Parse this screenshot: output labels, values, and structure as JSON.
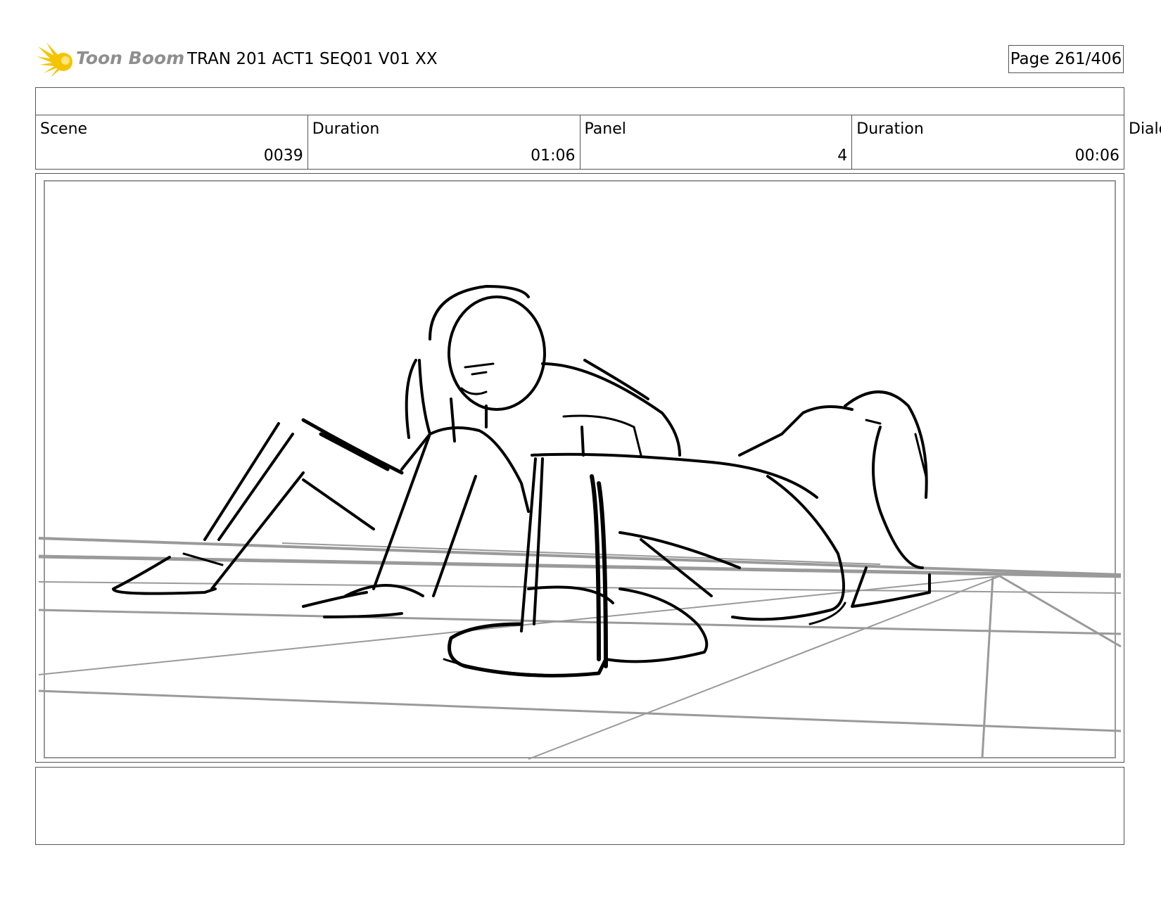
{
  "header": {
    "logo_text": "Toon Boom",
    "title": "TRAN 201 ACT1 SEQ01 V01 XX",
    "page": "Page 261/406"
  },
  "info": {
    "scene_label": "Scene",
    "scene_value": "0039",
    "scene_duration_label": "Duration",
    "scene_duration_value": "01:06",
    "panel_label": "Panel",
    "panel_value": "4",
    "panel_duration_label": "Duration",
    "panel_duration_value": "00:06",
    "dialog_label": "Dialog"
  },
  "colors": {
    "logo_star": "#f5c400",
    "logo_text": "#8f8f8f",
    "sketch_line": "#000000",
    "guide_line": "#9a9a9a"
  }
}
